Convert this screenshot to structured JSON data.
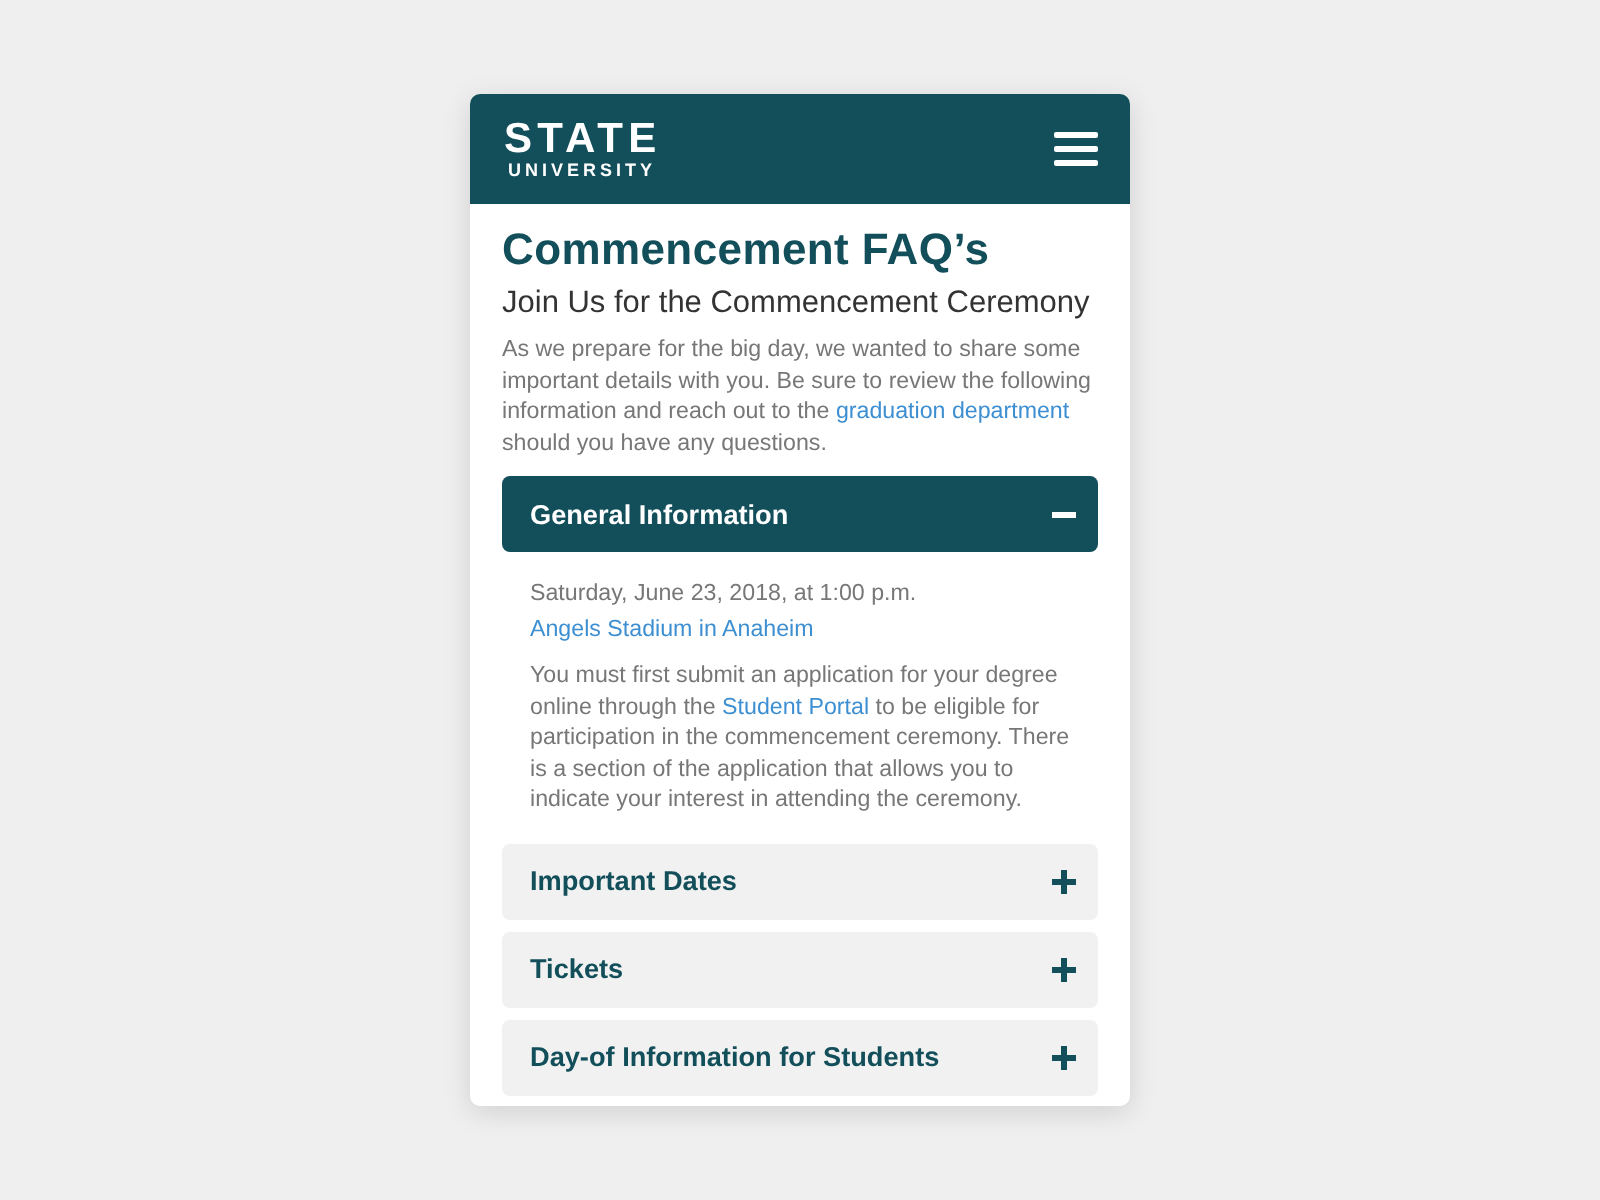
{
  "header": {
    "logo": {
      "primary": "STATE",
      "secondary": "UNIVERSITY"
    }
  },
  "page": {
    "title": "Commencement FAQ’s",
    "subtitle": "Join Us for the Commencement Ceremony",
    "intro": [
      {
        "kind": "text",
        "text": "As we prepare for the big day, we wanted to share some important details with you. Be sure to review the following information and reach out to the "
      },
      {
        "kind": "link",
        "text": "graduation department"
      },
      {
        "kind": "text",
        "text": " should you have any questions."
      }
    ]
  },
  "accordion": [
    {
      "title": "General Information",
      "expanded": true,
      "details": {
        "date": "Saturday, June 23, 2018, at 1:00 p.m.",
        "location": "Angels Stadium in Anaheim",
        "body": [
          {
            "kind": "text",
            "text": "You must first submit an application for your degree online through the "
          },
          {
            "kind": "link",
            "text": "Student Portal"
          },
          {
            "kind": "text",
            "text": " to be eligible for participation in the commencement ceremony. There is a section of the application that allows you to indicate your interest in attending the ceremony."
          }
        ]
      }
    },
    {
      "title": "Important Dates",
      "expanded": false
    },
    {
      "title": "Tickets",
      "expanded": false
    },
    {
      "title": "Day-of Information for Students",
      "expanded": false
    }
  ]
}
